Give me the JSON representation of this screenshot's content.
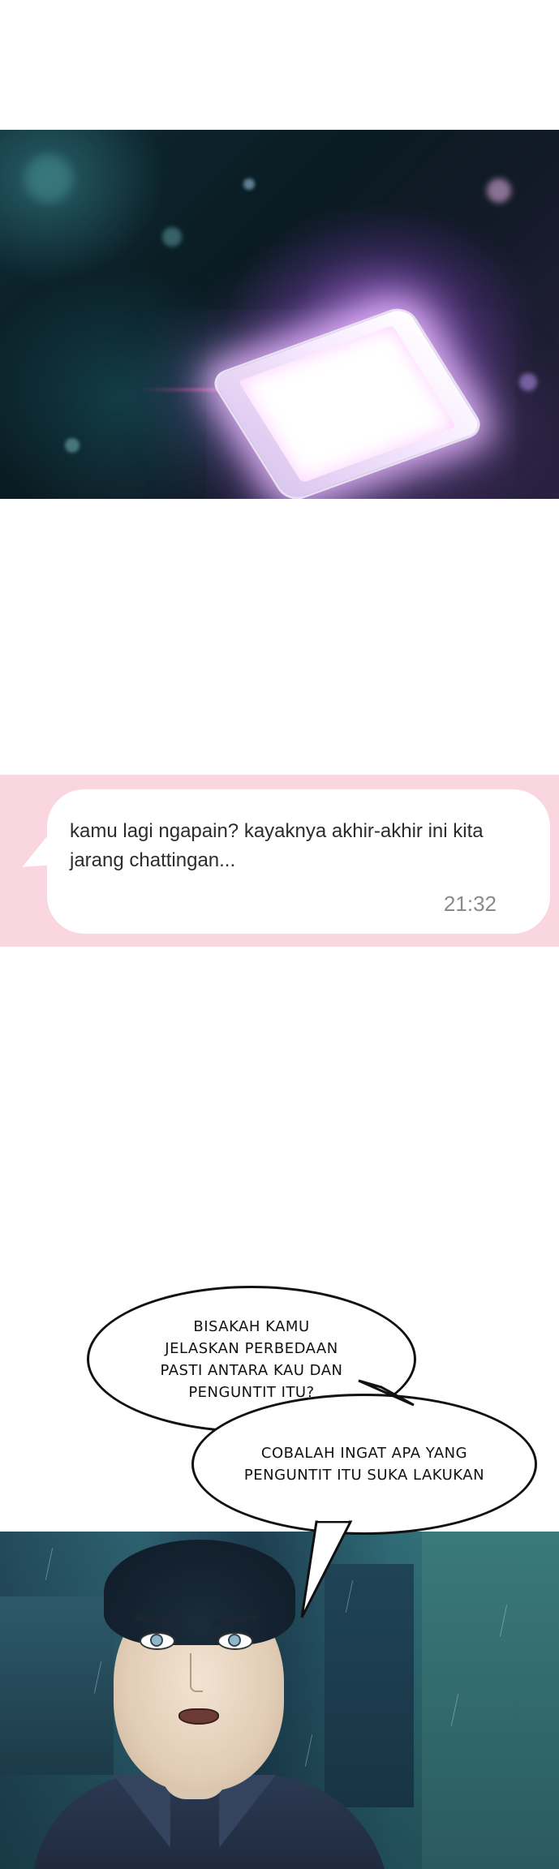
{
  "panels": {
    "phone": {
      "logo_text": "",
      "sub_text": ""
    },
    "chat": {
      "message": "kamu lagi ngapain? kayaknya akhir-akhir ini kita jarang chattingan...",
      "time": "21:32",
      "background_color": "#fad6e0"
    },
    "speech": {
      "bubble_1": "BISAKAH KAMU JELASKAN PERBEDAAN PASTI ANTARA KAU DAN PENGUNTIT ITU?",
      "bubble_2": "COBALAH INGAT APA YANG PENGUNTIT ITU SUKA LAKUKAN"
    }
  }
}
